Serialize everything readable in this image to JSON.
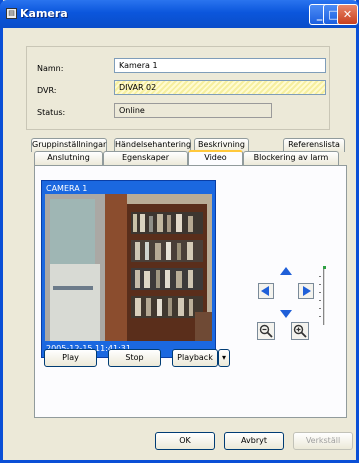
{
  "window": {
    "title": "Kamera"
  },
  "fields": {
    "name_label": "Namn:",
    "name_value": "Kamera 1",
    "dvr_label": "DVR:",
    "dvr_value": "DIVAR 02",
    "status_label": "Status:",
    "status_value": "Online"
  },
  "tabs_row1": [
    "Gruppinställningar",
    "Händelsehantering",
    "Beskrivning",
    "Referenslista"
  ],
  "tabs_row2": [
    "Anslutning",
    "Egenskaper",
    "Video",
    "Blockering av larm"
  ],
  "active_tab": "Video",
  "video": {
    "camera_name": "CAMERA 1",
    "timestamp": "2005-12-15 11:41:31"
  },
  "controls": {
    "play": "Play",
    "stop": "Stop",
    "playback": "Playback"
  },
  "dialog_buttons": {
    "ok": "OK",
    "cancel": "Avbryt",
    "apply": "Verkställ"
  },
  "icons": {
    "ptz_up": "arrow-up-icon",
    "ptz_left": "arrow-left-icon",
    "ptz_right": "arrow-right-icon",
    "ptz_down": "arrow-down-icon",
    "zoom_out": "zoom-out-icon",
    "zoom_in": "zoom-in-icon"
  },
  "colors": {
    "titlebar": "#0b56dc",
    "video_frame": "#1b68e0",
    "ptz_arrow": "#1f5fd8"
  }
}
